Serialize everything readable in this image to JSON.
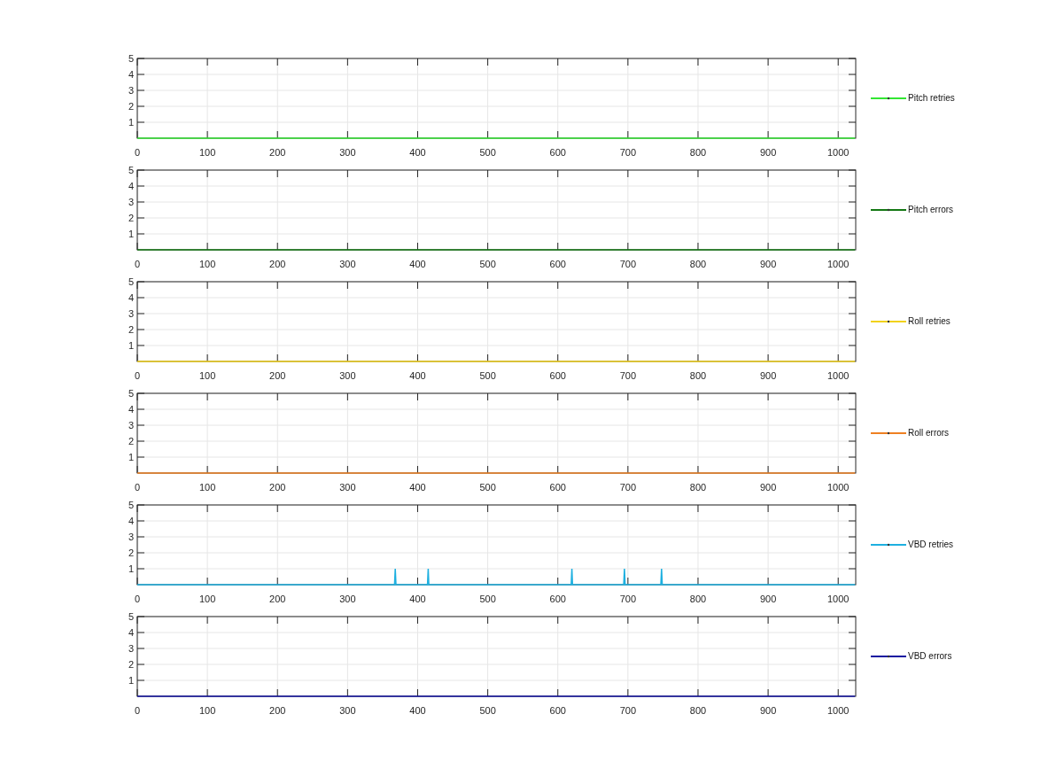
{
  "charts": [
    {
      "chart_data": {
        "type": "line",
        "x": [
          0,
          1024
        ],
        "grid": true,
        "series": [
          {
            "name": "Pitch retries",
            "color": "#33e633",
            "values": [
              0,
              0
            ]
          }
        ],
        "xlim": [
          0,
          1025
        ],
        "ylim": [
          0,
          5
        ],
        "xticks": [
          0,
          100,
          200,
          300,
          400,
          500,
          600,
          700,
          800,
          900,
          1000
        ],
        "yticks": [
          1,
          2,
          3,
          4,
          5
        ]
      }
    },
    {
      "chart_data": {
        "type": "line",
        "x": [
          0,
          1024
        ],
        "grid": true,
        "series": [
          {
            "name": "Pitch errors",
            "color": "#147814",
            "values": [
              0,
              0
            ]
          }
        ],
        "xlim": [
          0,
          1025
        ],
        "ylim": [
          0,
          5
        ],
        "xticks": [
          0,
          100,
          200,
          300,
          400,
          500,
          600,
          700,
          800,
          900,
          1000
        ],
        "yticks": [
          1,
          2,
          3,
          4,
          5
        ]
      }
    },
    {
      "chart_data": {
        "type": "line",
        "x": [
          0,
          1024
        ],
        "grid": true,
        "series": [
          {
            "name": "Roll retries",
            "color": "#f2d21a",
            "values": [
              0,
              0
            ]
          }
        ],
        "xlim": [
          0,
          1025
        ],
        "ylim": [
          0,
          5
        ],
        "xticks": [
          0,
          100,
          200,
          300,
          400,
          500,
          600,
          700,
          800,
          900,
          1000
        ],
        "yticks": [
          1,
          2,
          3,
          4,
          5
        ]
      }
    },
    {
      "chart_data": {
        "type": "line",
        "x": [
          0,
          1024
        ],
        "grid": true,
        "series": [
          {
            "name": "Roll errors",
            "color": "#ee8022",
            "values": [
              0,
              0
            ]
          }
        ],
        "xlim": [
          0,
          1025
        ],
        "ylim": [
          0,
          5
        ],
        "xticks": [
          0,
          100,
          200,
          300,
          400,
          500,
          600,
          700,
          800,
          900,
          1000
        ],
        "yticks": [
          1,
          2,
          3,
          4,
          5
        ]
      }
    },
    {
      "chart_data": {
        "type": "line",
        "x": [
          0,
          367,
          368,
          369,
          414,
          415,
          416,
          619,
          620,
          621,
          694,
          695,
          696,
          747,
          748,
          749,
          1024
        ],
        "grid": true,
        "series": [
          {
            "name": "VBD retries",
            "color": "#1eb0e0",
            "values": [
              0,
              0,
              1,
              0,
              0,
              1,
              0,
              0,
              1,
              0,
              0,
              1,
              0,
              0,
              1,
              0,
              0
            ]
          }
        ],
        "xlim": [
          0,
          1025
        ],
        "ylim": [
          0,
          5
        ],
        "xticks": [
          0,
          100,
          200,
          300,
          400,
          500,
          600,
          700,
          800,
          900,
          1000
        ],
        "yticks": [
          1,
          2,
          3,
          4,
          5
        ]
      }
    },
    {
      "chart_data": {
        "type": "line",
        "x": [
          0,
          1024
        ],
        "grid": true,
        "series": [
          {
            "name": "VBD errors",
            "color": "#1414a0",
            "values": [
              0,
              0
            ]
          }
        ],
        "xlim": [
          0,
          1025
        ],
        "ylim": [
          0,
          5
        ],
        "xticks": [
          0,
          100,
          200,
          300,
          400,
          500,
          600,
          700,
          800,
          900,
          1000
        ],
        "yticks": [
          1,
          2,
          3,
          4,
          5
        ]
      }
    }
  ]
}
